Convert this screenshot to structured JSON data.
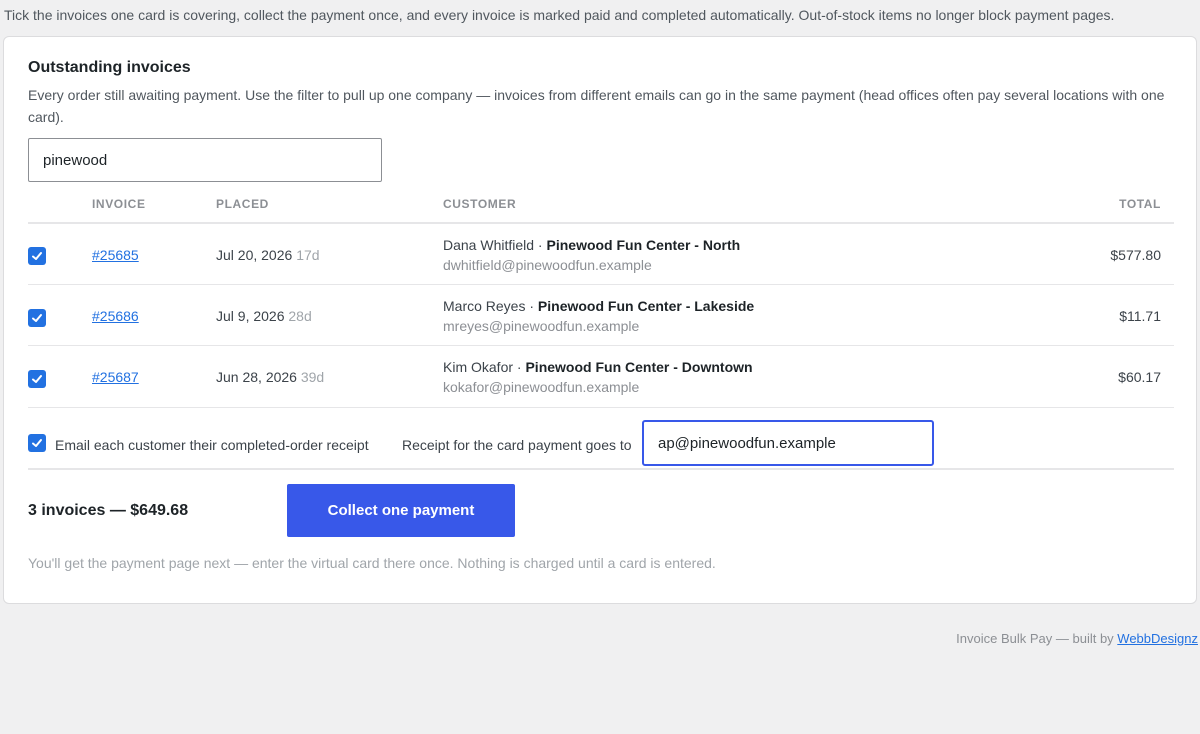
{
  "intro": "Tick the invoices one card is covering, collect the payment once, and every invoice is marked paid and completed automatically. Out-of-stock items no longer block payment pages.",
  "panel": {
    "title": "Outstanding invoices",
    "description": "Every order still awaiting payment. Use the filter to pull up one company — invoices from different emails can go in the same payment (head offices often pay several locations with one card).",
    "filter_value": "pinewood"
  },
  "table": {
    "headers": {
      "invoice": "INVOICE",
      "placed": "PLACED",
      "customer": "CUSTOMER",
      "total": "TOTAL"
    },
    "rows": [
      {
        "checked": true,
        "invoice": "#25685",
        "placed": "Jul 20, 2026",
        "age": "17d",
        "contact": "Dana Whitfield",
        "separator": " · ",
        "company": "Pinewood Fun Center - North",
        "email": "dwhitfield@pinewoodfun.example",
        "total": "$577.80"
      },
      {
        "checked": true,
        "invoice": "#25686",
        "placed": "Jul 9, 2026",
        "age": "28d",
        "contact": "Marco Reyes",
        "separator": " · ",
        "company": "Pinewood Fun Center - Lakeside",
        "email": "mreyes@pinewoodfun.example",
        "total": "$11.71"
      },
      {
        "checked": true,
        "invoice": "#25687",
        "placed": "Jun 28, 2026",
        "age": "39d",
        "contact": "Kim Okafor",
        "separator": " · ",
        "company": "Pinewood Fun Center - Downtown",
        "email": "kokafor@pinewoodfun.example",
        "total": "$60.17"
      }
    ]
  },
  "receipt": {
    "email_each_checked": true,
    "email_each_label": "Email each customer their completed-order receipt",
    "card_receipt_label": "Receipt for the card payment goes to",
    "card_receipt_value": "ap@pinewoodfun.example"
  },
  "footer": {
    "summary": "3 invoices — $649.68",
    "collect_label": "Collect one payment",
    "note": "You'll get the payment page next — enter the virtual card there once. Nothing is charged until a card is entered."
  },
  "credit": {
    "text": "Invoice Bulk Pay — built by ",
    "link": "WebbDesignz"
  },
  "colors": {
    "accent": "#3858e9",
    "checkbox": "#2271e1",
    "link": "#2271e1"
  },
  "icons": {
    "checkbox": "checkmark-icon"
  }
}
